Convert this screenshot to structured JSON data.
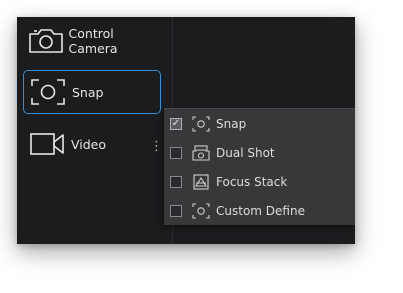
{
  "sidebar": {
    "items": [
      {
        "label": "Control Camera",
        "icon": "camera-icon"
      },
      {
        "label": "Snap",
        "icon": "snap-focus-icon",
        "selected": true
      },
      {
        "label": "Video",
        "icon": "video-icon"
      }
    ]
  },
  "dropdown": {
    "options": [
      {
        "label": "Snap",
        "checked": true,
        "icon": "snap-focus-icon"
      },
      {
        "label": "Dual Shot",
        "checked": false,
        "icon": "dual-shot-icon"
      },
      {
        "label": "Focus Stack",
        "checked": false,
        "icon": "focus-stack-icon"
      },
      {
        "label": "Custom Define",
        "checked": false,
        "icon": "custom-define-icon"
      }
    ]
  },
  "colors": {
    "accent": "#2e8fe0",
    "background": "#1c1c1f",
    "menu_background": "#38383b"
  }
}
